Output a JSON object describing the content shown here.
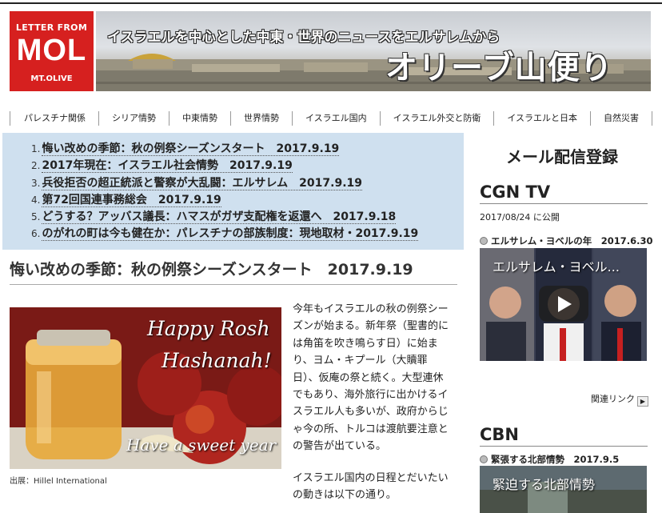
{
  "header": {
    "logo": {
      "line1": "LETTER FROM",
      "line2": "MOL",
      "line3": "MT.OLIVE"
    },
    "tagline": "イスラエルを中心とした中東・世界のニュースをエルサレムから",
    "site_title": "オリーブ山便り"
  },
  "nav": {
    "items": [
      "パレスチナ関係",
      "シリア情勢",
      "中東情勢",
      "世界情勢",
      "イスラエル国内",
      "イスラエル外交と防衛",
      "イスラエルと日本",
      "自然災害"
    ]
  },
  "headlines": [
    {
      "num": "1.",
      "text": "悔い改めの季節：秋の例祭シーズンスタート　2017.9.19"
    },
    {
      "num": "2.",
      "text": "2017年現在：イスラエル社会情勢　2017.9.19"
    },
    {
      "num": "3.",
      "text": "兵役拒否の超正統派と警察が大乱闘：エルサレム　2017.9.19"
    },
    {
      "num": "4.",
      "text": "第72回国連事務総会　2017.9.19"
    },
    {
      "num": "5.",
      "text": "どうする？アッバス議長：ハマスがガザ支配権を返還へ　2017.9.18"
    },
    {
      "num": "6.",
      "text": "のがれの町は今も健在か：パレスチナの部族制度：現地取材・2017.9.19"
    }
  ],
  "article": {
    "title": "悔い改めの季節：秋の例祭シーズンスタート　2017.9.19",
    "image_text": {
      "line1": "Happy Rosh",
      "line2": "Hashanah!",
      "line3": "Have a sweet year"
    },
    "caption": "出展：Hillel International",
    "paragraph1": "今年もイスラエルの秋の例祭シーズンが始まる。新年祭（聖書的には角笛を吹き鳴らす日）に始まり、ヨム・キプール（大贖罪日）、仮庵の祭と続く。大型連休でもあり、海外旅行に出かけるイスラエル人も多いが、政府からじゃ今の所、トルコは渡航要注意との警告が出ている。",
    "paragraph2": "イスラエル国内の日程とだいたいの動きは以下の通り。"
  },
  "sidebar": {
    "mail_signup": "メール配信登録",
    "cgn": {
      "title": "CGN TV",
      "date": "2017/08/24 に公開",
      "video_label": "エルサレム・ヨベルの年　2017.6.30",
      "video_overlay": "エルサレム・ヨベル..."
    },
    "related_link": "関連リンク",
    "cbn": {
      "title": "CBN",
      "video_label": "緊張する北部情勢　2017.9.5",
      "video_overlay": "緊迫する北部情勢"
    }
  },
  "colors": {
    "logo_red": "#d6201f",
    "headline_bg": "#cfe0ef"
  }
}
